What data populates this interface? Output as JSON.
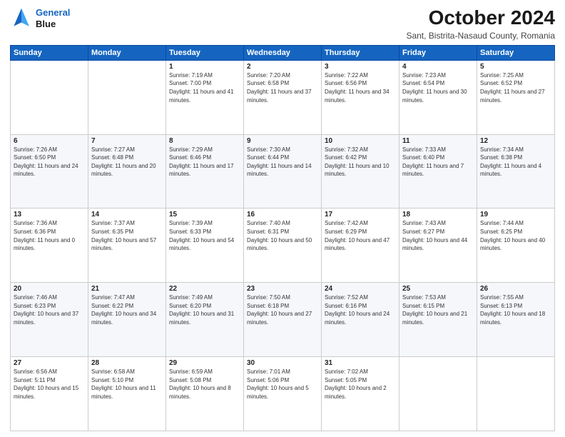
{
  "header": {
    "logo_line1": "General",
    "logo_line2": "Blue",
    "month": "October 2024",
    "location": "Sant, Bistrita-Nasaud County, Romania"
  },
  "weekdays": [
    "Sunday",
    "Monday",
    "Tuesday",
    "Wednesday",
    "Thursday",
    "Friday",
    "Saturday"
  ],
  "weeks": [
    [
      {
        "day": null
      },
      {
        "day": null
      },
      {
        "day": "1",
        "sunrise": "Sunrise: 7:19 AM",
        "sunset": "Sunset: 7:00 PM",
        "daylight": "Daylight: 11 hours and 41 minutes."
      },
      {
        "day": "2",
        "sunrise": "Sunrise: 7:20 AM",
        "sunset": "Sunset: 6:58 PM",
        "daylight": "Daylight: 11 hours and 37 minutes."
      },
      {
        "day": "3",
        "sunrise": "Sunrise: 7:22 AM",
        "sunset": "Sunset: 6:56 PM",
        "daylight": "Daylight: 11 hours and 34 minutes."
      },
      {
        "day": "4",
        "sunrise": "Sunrise: 7:23 AM",
        "sunset": "Sunset: 6:54 PM",
        "daylight": "Daylight: 11 hours and 30 minutes."
      },
      {
        "day": "5",
        "sunrise": "Sunrise: 7:25 AM",
        "sunset": "Sunset: 6:52 PM",
        "daylight": "Daylight: 11 hours and 27 minutes."
      }
    ],
    [
      {
        "day": "6",
        "sunrise": "Sunrise: 7:26 AM",
        "sunset": "Sunset: 6:50 PM",
        "daylight": "Daylight: 11 hours and 24 minutes."
      },
      {
        "day": "7",
        "sunrise": "Sunrise: 7:27 AM",
        "sunset": "Sunset: 6:48 PM",
        "daylight": "Daylight: 11 hours and 20 minutes."
      },
      {
        "day": "8",
        "sunrise": "Sunrise: 7:29 AM",
        "sunset": "Sunset: 6:46 PM",
        "daylight": "Daylight: 11 hours and 17 minutes."
      },
      {
        "day": "9",
        "sunrise": "Sunrise: 7:30 AM",
        "sunset": "Sunset: 6:44 PM",
        "daylight": "Daylight: 11 hours and 14 minutes."
      },
      {
        "day": "10",
        "sunrise": "Sunrise: 7:32 AM",
        "sunset": "Sunset: 6:42 PM",
        "daylight": "Daylight: 11 hours and 10 minutes."
      },
      {
        "day": "11",
        "sunrise": "Sunrise: 7:33 AM",
        "sunset": "Sunset: 6:40 PM",
        "daylight": "Daylight: 11 hours and 7 minutes."
      },
      {
        "day": "12",
        "sunrise": "Sunrise: 7:34 AM",
        "sunset": "Sunset: 6:38 PM",
        "daylight": "Daylight: 11 hours and 4 minutes."
      }
    ],
    [
      {
        "day": "13",
        "sunrise": "Sunrise: 7:36 AM",
        "sunset": "Sunset: 6:36 PM",
        "daylight": "Daylight: 11 hours and 0 minutes."
      },
      {
        "day": "14",
        "sunrise": "Sunrise: 7:37 AM",
        "sunset": "Sunset: 6:35 PM",
        "daylight": "Daylight: 10 hours and 57 minutes."
      },
      {
        "day": "15",
        "sunrise": "Sunrise: 7:39 AM",
        "sunset": "Sunset: 6:33 PM",
        "daylight": "Daylight: 10 hours and 54 minutes."
      },
      {
        "day": "16",
        "sunrise": "Sunrise: 7:40 AM",
        "sunset": "Sunset: 6:31 PM",
        "daylight": "Daylight: 10 hours and 50 minutes."
      },
      {
        "day": "17",
        "sunrise": "Sunrise: 7:42 AM",
        "sunset": "Sunset: 6:29 PM",
        "daylight": "Daylight: 10 hours and 47 minutes."
      },
      {
        "day": "18",
        "sunrise": "Sunrise: 7:43 AM",
        "sunset": "Sunset: 6:27 PM",
        "daylight": "Daylight: 10 hours and 44 minutes."
      },
      {
        "day": "19",
        "sunrise": "Sunrise: 7:44 AM",
        "sunset": "Sunset: 6:25 PM",
        "daylight": "Daylight: 10 hours and 40 minutes."
      }
    ],
    [
      {
        "day": "20",
        "sunrise": "Sunrise: 7:46 AM",
        "sunset": "Sunset: 6:23 PM",
        "daylight": "Daylight: 10 hours and 37 minutes."
      },
      {
        "day": "21",
        "sunrise": "Sunrise: 7:47 AM",
        "sunset": "Sunset: 6:22 PM",
        "daylight": "Daylight: 10 hours and 34 minutes."
      },
      {
        "day": "22",
        "sunrise": "Sunrise: 7:49 AM",
        "sunset": "Sunset: 6:20 PM",
        "daylight": "Daylight: 10 hours and 31 minutes."
      },
      {
        "day": "23",
        "sunrise": "Sunrise: 7:50 AM",
        "sunset": "Sunset: 6:18 PM",
        "daylight": "Daylight: 10 hours and 27 minutes."
      },
      {
        "day": "24",
        "sunrise": "Sunrise: 7:52 AM",
        "sunset": "Sunset: 6:16 PM",
        "daylight": "Daylight: 10 hours and 24 minutes."
      },
      {
        "day": "25",
        "sunrise": "Sunrise: 7:53 AM",
        "sunset": "Sunset: 6:15 PM",
        "daylight": "Daylight: 10 hours and 21 minutes."
      },
      {
        "day": "26",
        "sunrise": "Sunrise: 7:55 AM",
        "sunset": "Sunset: 6:13 PM",
        "daylight": "Daylight: 10 hours and 18 minutes."
      }
    ],
    [
      {
        "day": "27",
        "sunrise": "Sunrise: 6:56 AM",
        "sunset": "Sunset: 5:11 PM",
        "daylight": "Daylight: 10 hours and 15 minutes."
      },
      {
        "day": "28",
        "sunrise": "Sunrise: 6:58 AM",
        "sunset": "Sunset: 5:10 PM",
        "daylight": "Daylight: 10 hours and 11 minutes."
      },
      {
        "day": "29",
        "sunrise": "Sunrise: 6:59 AM",
        "sunset": "Sunset: 5:08 PM",
        "daylight": "Daylight: 10 hours and 8 minutes."
      },
      {
        "day": "30",
        "sunrise": "Sunrise: 7:01 AM",
        "sunset": "Sunset: 5:06 PM",
        "daylight": "Daylight: 10 hours and 5 minutes."
      },
      {
        "day": "31",
        "sunrise": "Sunrise: 7:02 AM",
        "sunset": "Sunset: 5:05 PM",
        "daylight": "Daylight: 10 hours and 2 minutes."
      },
      {
        "day": null
      },
      {
        "day": null
      }
    ]
  ]
}
